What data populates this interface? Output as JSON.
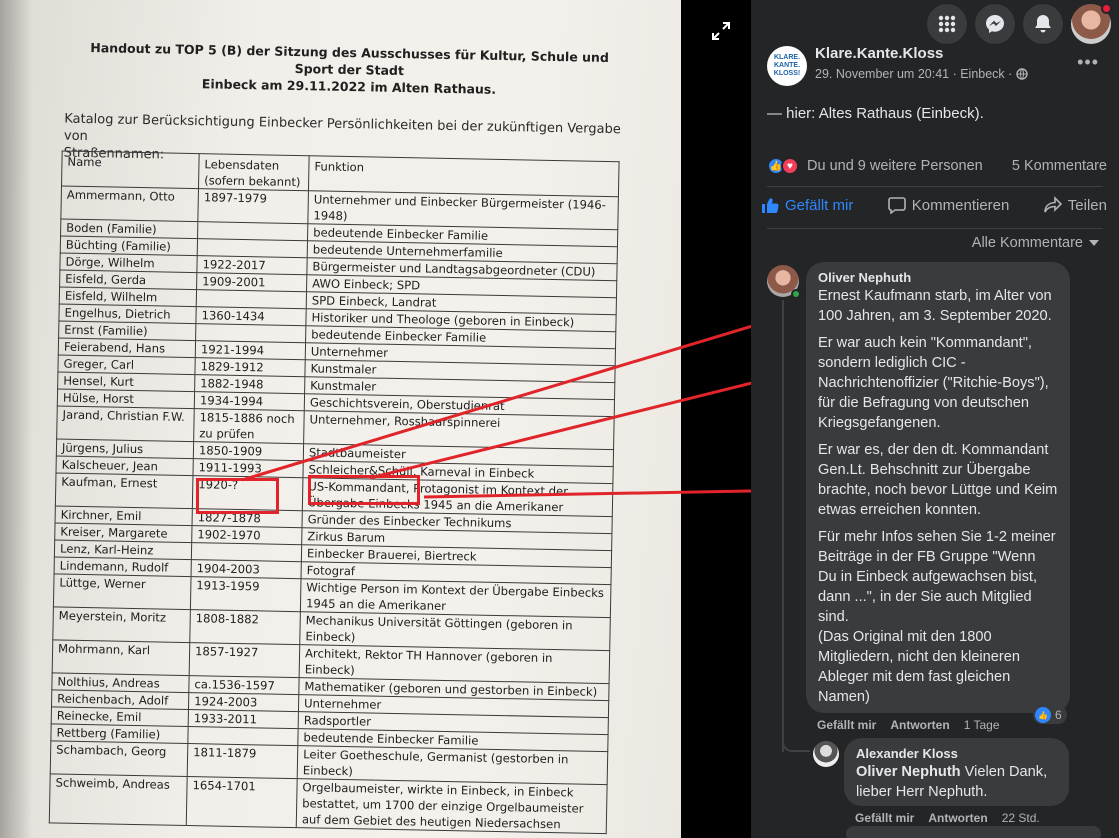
{
  "document": {
    "title_line1": "Handout zu TOP 5 (B) der Sitzung des Ausschusses für Kultur, Schule und Sport der Stadt",
    "title_line2": "Einbeck am 29.11.2022 im Alten Rathaus.",
    "intro_line1": "Katalog zur Berücksichtigung Einbecker Persönlichkeiten bei der zukünftigen Vergabe von",
    "intro_line2": "Straßennamen:",
    "headers": [
      "Name",
      "Lebensdaten (sofern bekannt)",
      "Funktion"
    ],
    "rows": [
      [
        "Ammermann, Otto",
        "1897-1979",
        "Unternehmer und Einbecker Bürgermeister (1946-1948)"
      ],
      [
        "Boden (Familie)",
        "",
        "bedeutende Einbecker Familie"
      ],
      [
        "Büchting (Familie)",
        "",
        "bedeutende Unternehmerfamilie"
      ],
      [
        "Dörge, Wilhelm",
        "1922-2017",
        "Bürgermeister und Landtagsabgeordneter (CDU)"
      ],
      [
        "Eisfeld, Gerda",
        "1909-2001",
        "AWO Einbeck; SPD"
      ],
      [
        "Eisfeld, Wilhelm",
        "",
        "SPD Einbeck, Landrat"
      ],
      [
        "Engelhus, Dietrich",
        "1360-1434",
        "Historiker und Theologe (geboren in Einbeck)"
      ],
      [
        "Ernst (Familie)",
        "",
        "bedeutende Einbecker Familie"
      ],
      [
        "Feierabend, Hans",
        "1921-1994",
        "Unternehmer"
      ],
      [
        "Greger, Carl",
        "1829-1912",
        "Kunstmaler"
      ],
      [
        "Hensel, Kurt",
        "1882-1948",
        "Kunstmaler"
      ],
      [
        "Hülse, Horst",
        "1934-1994",
        "Geschichtsverein, Oberstudienrat"
      ],
      [
        "Jarand, Christian F.W.",
        "1815-1886 noch zu prüfen",
        "Unternehmer, Rosshaarspinnerei"
      ],
      [
        "Jürgens, Julius",
        "1850-1909",
        "Stadtbaumeister"
      ],
      [
        "Kalscheuer, Jean",
        "1911-1993",
        "Schleicher&Schüll, Karneval in Einbeck"
      ],
      [
        "Kaufman, Ernest",
        "1920-?",
        "US-Kommandant, Protagonist im Kontext der Übergabe Einbecks 1945 an die Amerikaner"
      ],
      [
        "Kirchner, Emil",
        "1827-1878",
        "Gründer des Einbecker Technikums"
      ],
      [
        "Kreiser, Margarete",
        "1902-1970",
        "Zirkus Barum"
      ],
      [
        "Lenz, Karl-Heinz",
        "",
        "Einbecker Brauerei, Biertreck"
      ],
      [
        "Lindemann, Rudolf",
        "1904-2003",
        "Fotograf"
      ],
      [
        "Lüttge, Werner",
        "1913-1959",
        "Wichtige Person im Kontext der Übergabe Einbecks 1945 an die Amerikaner"
      ],
      [
        "Meyerstein, Moritz",
        "1808-1882",
        "Mechanikus Universität Göttingen (geboren in Einbeck)"
      ],
      [
        "Mohrmann, Karl",
        "1857-1927",
        "Architekt, Rektor TH Hannover (geboren in Einbeck)"
      ],
      [
        "Nolthius, Andreas",
        "ca.1536-1597",
        "Mathematiker (geboren und gestorben in Einbeck)"
      ],
      [
        "Reichenbach, Adolf",
        "1924-2003",
        "Unternehmer"
      ],
      [
        "Reinecke, Emil",
        "1933-2011",
        "Radsportler"
      ],
      [
        "Rettberg (Familie)",
        "",
        "bedeutende Einbecker Familie"
      ],
      [
        "Schambach, Georg",
        "1811-1879",
        "Leiter Goetheschule, Germanist (gestorben in Einbeck)"
      ],
      [
        "Schweimb, Andreas",
        "1654-1701",
        "Orgelbaumeister, wirkte in Einbeck, in Einbeck bestattet, um 1700 der einzige Orgelbaumeister auf dem Gebiet des heutigen Niedersachsen"
      ]
    ]
  },
  "post": {
    "page_name": "Klare.Kante.Kloss",
    "page_logo_text": "KLARE. KANTE. KLOSS!",
    "timestamp": "29. November um 20:41 · Einbeck ·",
    "text_prefix": "— hier: ",
    "text_bold": "Altes Rathaus (Einbeck).",
    "reactions_text": "Du und 9 weitere Personen",
    "comments_count": "5 Kommentare",
    "action_like": "Gefällt mir",
    "action_comment": "Kommentieren",
    "action_share": "Teilen",
    "all_comments": "Alle Kommentare"
  },
  "comments": [
    {
      "author": "Oliver Nephuth",
      "paragraphs": [
        "Ernest Kaufmann starb, im Alter von 100 Jahren, am 3. September 2020.",
        "Er war auch kein \"Kommandant\", sondern lediglich CIC - Nachrichtenoffizier (\"Ritchie-Boys\"), für die Befragung von deutschen Kriegsgefangenen.",
        "Er war es, der den dt. Kommandant Gen.Lt. Behschnitt zur Übergabe brachte, noch bevor Lüttge und Keim etwas erreichen konnten.",
        "Für mehr Infos sehen Sie 1-2 meiner Beiträge in der FB Gruppe \"Wenn Du in Einbeck aufgewachsen bist, dann ...\", in der Sie auch Mitglied sind.",
        "(Das Original mit den 1800 Mitgliedern, nicht den kleineren Ableger mit dem fast gleichen Namen)"
      ],
      "like_label": "Gefällt mir",
      "reply_label": "Antworten",
      "age": "1 Tage",
      "like_count": "6"
    },
    {
      "author": "Alexander Kloss",
      "mention": "Oliver Nephuth",
      "text": " Vielen Dank, lieber Herr Nephuth.",
      "like_label": "Gefällt mir",
      "reply_label": "Antworten",
      "age": "22 Std."
    }
  ],
  "colors": {
    "fb_bg": "#242526",
    "bubble": "#3a3b3c",
    "accent": "#2d88ff",
    "mark_red": "#e0242a"
  }
}
